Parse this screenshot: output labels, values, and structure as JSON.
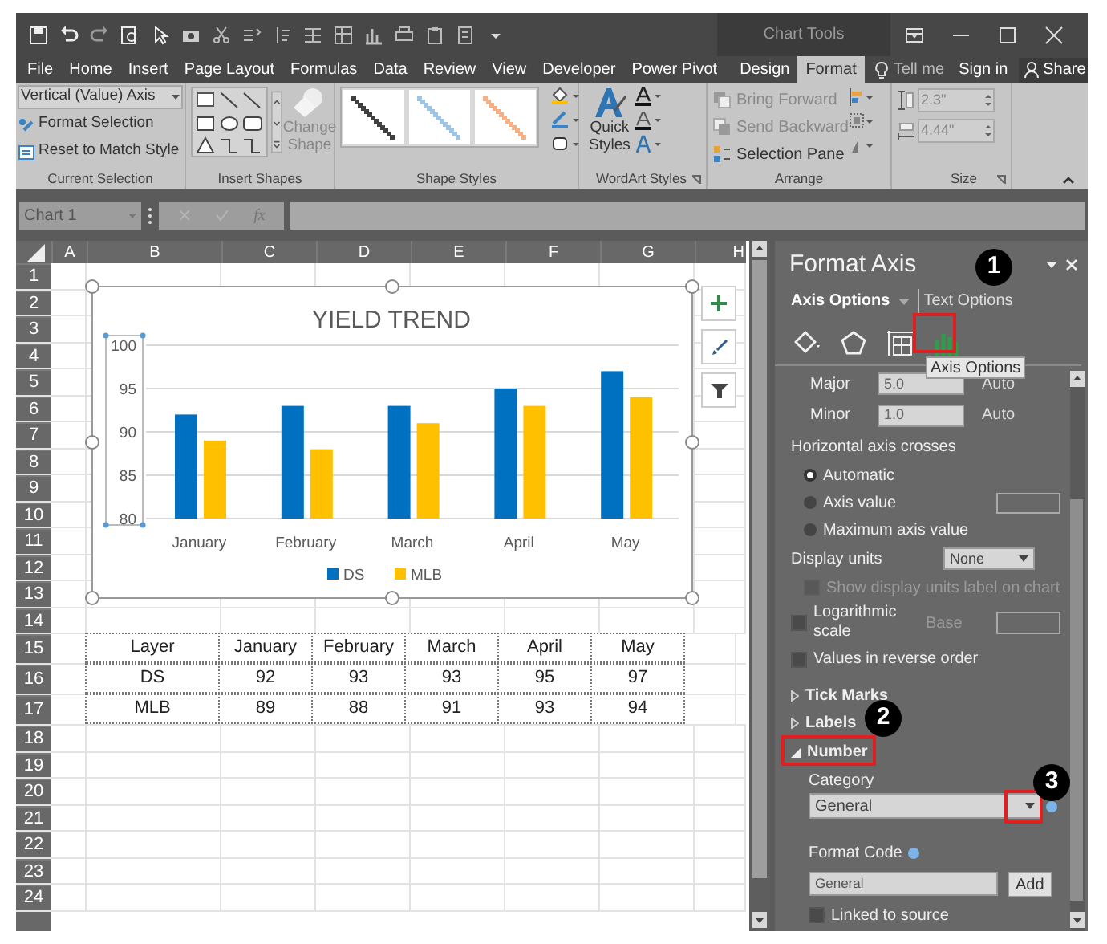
{
  "title_bar": {
    "context_label": "Chart Tools"
  },
  "ribbon_tabs": [
    {
      "label": "File",
      "selected": false
    },
    {
      "label": "Home",
      "selected": false
    },
    {
      "label": "Insert",
      "selected": false
    },
    {
      "label": "Page Layout",
      "selected": false
    },
    {
      "label": "Formulas",
      "selected": false
    },
    {
      "label": "Data",
      "selected": false
    },
    {
      "label": "Review",
      "selected": false
    },
    {
      "label": "View",
      "selected": false
    },
    {
      "label": "Developer",
      "selected": false
    },
    {
      "label": "Power Pivot",
      "selected": false
    },
    {
      "label": "Design",
      "selected": false
    },
    {
      "label": "Format",
      "selected": true
    }
  ],
  "tell_me": "Tell me",
  "sign_in": "Sign in",
  "share": "Share",
  "current_selection": {
    "dropdown": "Vertical (Value) Axis",
    "format_selection": "Format Selection",
    "reset": "Reset to Match Style",
    "label": "Current Selection"
  },
  "insert_shapes": {
    "change_shape": "Change",
    "change_shape_2": "Shape",
    "change_shape_disabled": true,
    "label": "Insert Shapes"
  },
  "shape_styles": {
    "swatches": [
      {
        "color": "#404040"
      },
      {
        "color": "#9dc3e6"
      },
      {
        "color": "#f4b183"
      }
    ],
    "label": "Shape Styles"
  },
  "wordart_styles": {
    "quick": "Quick",
    "styles": "Styles",
    "label": "WordArt Styles"
  },
  "arrange": {
    "commands": [
      {
        "label": "Bring Forward",
        "disabled": true
      },
      {
        "label": "Send Backward",
        "disabled": true
      },
      {
        "label": "Selection Pane",
        "disabled": false
      }
    ],
    "label": "Arrange"
  },
  "size": {
    "height": "2.3\"",
    "width": "4.44\"",
    "label": "Size"
  },
  "formula_bar": {
    "name_box": "Chart 1",
    "fx": "fx"
  },
  "sheet": {
    "columns": [
      "A",
      "B",
      "C",
      "D",
      "E",
      "F",
      "G",
      "H"
    ],
    "rows": [
      "1",
      "2",
      "3",
      "4",
      "5",
      "6",
      "7",
      "8",
      "9",
      "10",
      "11",
      "12",
      "13",
      "14",
      "15",
      "16",
      "17",
      "18",
      "19",
      "20",
      "21",
      "22",
      "23",
      "24"
    ],
    "table": {
      "columns": [
        "Layer",
        "January",
        "February",
        "March",
        "April",
        "May"
      ],
      "rows": [
        [
          "DS",
          "92",
          "93",
          "93",
          "95",
          "97"
        ],
        [
          "MLB",
          "89",
          "88",
          "91",
          "93",
          "94"
        ]
      ]
    }
  },
  "chart": {
    "chart_data": {
      "type": "bar",
      "title": "YIELD TREND",
      "categories": [
        "January",
        "February",
        "March",
        "April",
        "May"
      ],
      "series": [
        {
          "name": "DS",
          "color": "#0070c0",
          "values": [
            92,
            93,
            93,
            95,
            97
          ]
        },
        {
          "name": "MLB",
          "color": "#ffc000",
          "values": [
            89,
            88,
            91,
            93,
            94
          ]
        }
      ],
      "ylim": [
        80,
        100
      ],
      "yticks": [
        80,
        85,
        90,
        95,
        100
      ],
      "grid": true,
      "legend": "bottom"
    }
  },
  "format_pane": {
    "title": "Format Axis",
    "tabs": [
      {
        "label": "Axis Options",
        "selected": true
      },
      {
        "label": "Text Options",
        "selected": false
      }
    ],
    "icon_tabs": [
      {
        "kind": "fill",
        "selected": false
      },
      {
        "kind": "effects",
        "selected": false
      },
      {
        "kind": "size",
        "selected": false
      },
      {
        "kind": "axis",
        "selected": true
      }
    ],
    "tooltip": "Axis Options",
    "units": [
      {
        "label": "Major",
        "value": "5.0",
        "reset": "Auto"
      },
      {
        "label": "Minor",
        "value": "1.0",
        "reset": "Auto"
      }
    ],
    "crosses": {
      "label": "Horizontal axis crosses",
      "options": [
        {
          "label": "Automatic",
          "selected": true
        },
        {
          "label": "Axis value",
          "selected": false
        },
        {
          "label": "Maximum axis value",
          "selected": false
        }
      ]
    },
    "display_units": {
      "label": "Display units",
      "value": "None"
    },
    "show_units": {
      "label": "Show display units label on chart",
      "checked": false,
      "disabled": true
    },
    "log": {
      "label": "Logarithmic",
      "label_2": "scale",
      "checked": false,
      "base": "Base"
    },
    "reverse": {
      "label": "Values in reverse order",
      "checked": false
    },
    "sections": [
      {
        "label": "Tick Marks",
        "expanded": false
      },
      {
        "label": "Labels",
        "expanded": false
      },
      {
        "label": "Number",
        "expanded": true
      }
    ],
    "number": {
      "category_label": "Category",
      "category": "General",
      "format_code_label": "Format Code",
      "format_code": "General",
      "add": "Add",
      "linked": {
        "label": "Linked to source",
        "checked": false
      }
    }
  },
  "callouts": [
    "1",
    "2",
    "3"
  ]
}
